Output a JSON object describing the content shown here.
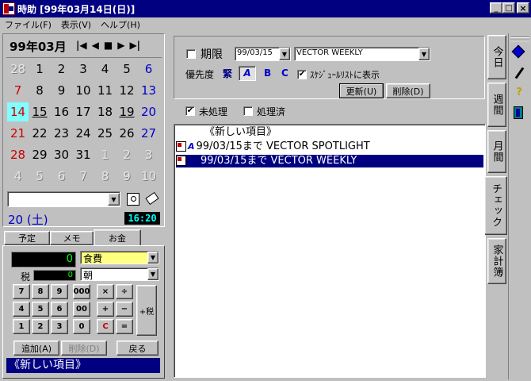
{
  "window": {
    "title": "時助 [99年03月14日(日)]",
    "min": "_",
    "max": "□",
    "close": "×"
  },
  "menu": [
    "ファイル(F)",
    "表示(V)",
    "ヘルプ(H)"
  ],
  "calendar": {
    "month_label": "99年03月",
    "nav": [
      "|◀",
      "◀",
      "■",
      "▶",
      "▶|"
    ],
    "weeks": [
      [
        "28",
        "1",
        "2",
        "3",
        "4",
        "5",
        "6"
      ],
      [
        "7",
        "8",
        "9",
        "10",
        "11",
        "12",
        "13"
      ],
      [
        "14",
        "15",
        "16",
        "17",
        "18",
        "19",
        "20"
      ],
      [
        "21",
        "22",
        "23",
        "24",
        "25",
        "26",
        "27"
      ],
      [
        "28",
        "29",
        "30",
        "31",
        "1",
        "2",
        "3"
      ],
      [
        "4",
        "5",
        "6",
        "7",
        "8",
        "9",
        "10"
      ]
    ],
    "selected_day_label": "20 (土)",
    "clock": "16:20"
  },
  "left_tabs": [
    "予定",
    "メモ",
    "お金"
  ],
  "money": {
    "amount": "0",
    "tax_label": "税",
    "tax_value": "0",
    "category": "食費",
    "time": "朝",
    "keys_row1": [
      "7",
      "8",
      "9",
      "000",
      "×",
      "÷"
    ],
    "keys_row2": [
      "4",
      "5",
      "6",
      "00",
      "+",
      "−"
    ],
    "keys_row3": [
      "1",
      "2",
      "3",
      "0",
      "C",
      "="
    ],
    "tax_key": "+税",
    "add_button": "追加(A)",
    "delete_button": "削除(D)",
    "back_button": "戻る",
    "status": "《新しい項目》"
  },
  "filter": {
    "due_label": "期限",
    "due_date": "99/03/15",
    "item_name": "VECTOR WEEKLY",
    "priority_label": "優先度",
    "priority_value": "緊",
    "priority_a": "A",
    "priority_b": "B",
    "priority_c": "C",
    "schedule_check_label": "ｽｹｼﾞｭｰﾙﾘｽﾄに表示",
    "update_button": "更新(U)",
    "delete_button": "削除(D)",
    "unprocessed_label": "未処理",
    "processed_label": "処理済"
  },
  "list": {
    "items": [
      {
        "text": "《新しい項目》",
        "selected": false
      },
      {
        "text": "99/03/15まで VECTOR SPOTLIGHT",
        "selected": false
      },
      {
        "text": "99/03/15まで VECTOR WEEKLY",
        "selected": true
      }
    ]
  },
  "right_tabs": [
    "今日",
    "週間",
    "月間",
    "チェック",
    "家計簿"
  ],
  "colors": {
    "title_bg": "#000080",
    "selection": "#000080",
    "sunday": "#cc0000",
    "saturday": "#0000cc",
    "today_bg": "#80ffff",
    "category_bg": "#ffff80"
  }
}
